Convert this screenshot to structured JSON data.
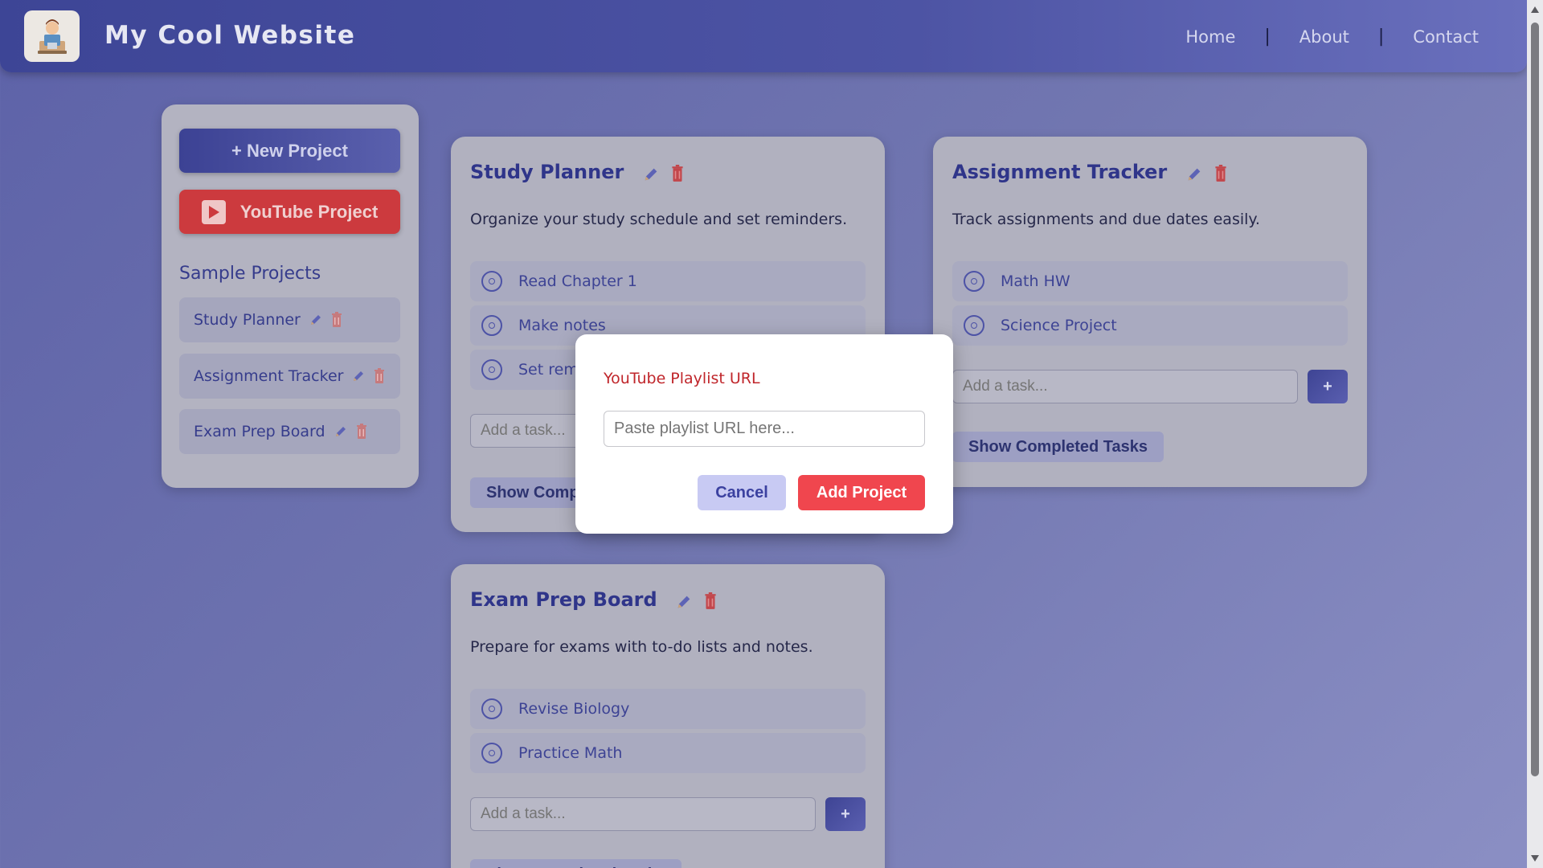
{
  "header": {
    "site_title": "My Cool Website",
    "nav": {
      "home": "Home",
      "about": "About",
      "contact": "Contact",
      "separator": "|"
    }
  },
  "sidebar": {
    "new_project_label": "+ New Project",
    "youtube_project_label": "YouTube Project",
    "sample_title": "Sample Projects",
    "items": [
      {
        "label": "Study Planner"
      },
      {
        "label": "Assignment Tracker"
      },
      {
        "label": "Exam Prep Board"
      }
    ]
  },
  "projects": [
    {
      "title": "Study Planner",
      "description": "Organize your study schedule and set reminders.",
      "tasks": [
        "Read Chapter 1",
        "Make notes",
        "Set reminders"
      ],
      "add_placeholder": "Add a task...",
      "add_label": "+",
      "show_completed_label": "Show Completed Tasks"
    },
    {
      "title": "Assignment Tracker",
      "description": "Track assignments and due dates easily.",
      "tasks": [
        "Math HW",
        "Science Project"
      ],
      "add_placeholder": "Add a task...",
      "add_label": "+",
      "show_completed_label": "Show Completed Tasks"
    },
    {
      "title": "Exam Prep Board",
      "description": "Prepare for exams with to-do lists and notes.",
      "tasks": [
        "Revise Biology",
        "Practice Math"
      ],
      "add_placeholder": "Add a task...",
      "add_label": "+",
      "show_completed_label": "Show Completed Tasks"
    }
  ],
  "modal": {
    "label": "YouTube Playlist URL",
    "placeholder": "Paste playlist URL here...",
    "cancel_label": "Cancel",
    "add_label": "Add Project"
  },
  "colors": {
    "accent": "#3d4596",
    "youtube_red": "#cc3a3e",
    "add_project_red": "#f0464e",
    "title_blue": "#2f358a"
  },
  "icons": [
    "avatar-logo",
    "youtube-play-icon",
    "pencil-icon",
    "trash-icon",
    "radio-circle-icon",
    "plus-icon"
  ]
}
